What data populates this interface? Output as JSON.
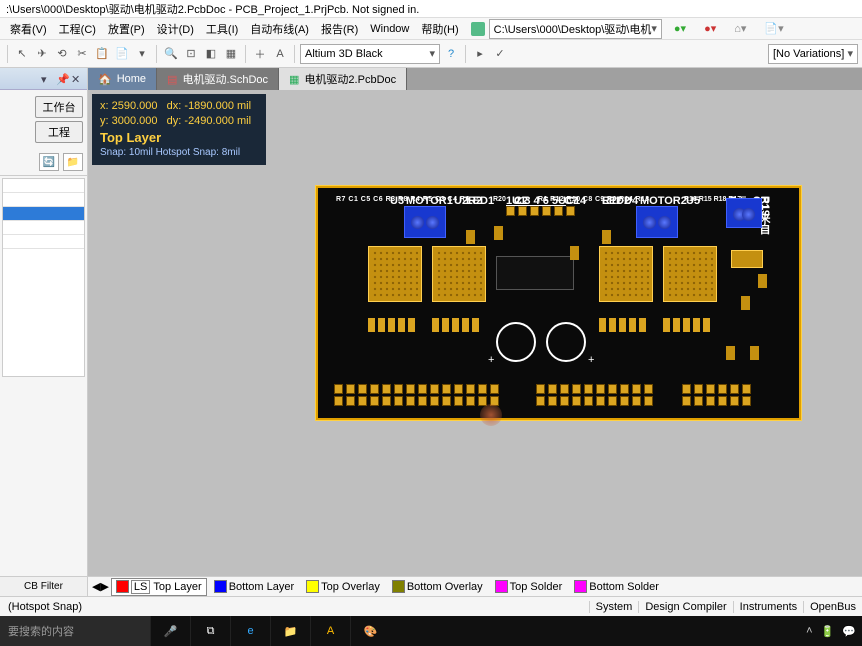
{
  "title": ":\\Users\\000\\Desktop\\驱动\\电机驱动2.PcbDoc - PCB_Project_1.PrjPcb. Not signed in.",
  "menus": {
    "m0": "察看(V)",
    "m1": "工程(C)",
    "m2": "放置(P)",
    "m3": "设计(D)",
    "m4": "工具(I)",
    "m5": "自动布线(A)",
    "m6": "报告(R)",
    "m7": "Window",
    "m8": "帮助(H)"
  },
  "breadcrumb": "C:\\Users\\000\\Desktop\\驱动\\电机",
  "toolbar": {
    "theme": "Altium 3D Black",
    "variations": "[No Variations]"
  },
  "sidebar": {
    "btn1": "工作台",
    "btn2": "工程",
    "footer": "CB Filter"
  },
  "tabs": {
    "home": "Home",
    "t1": "电机驱动.SchDoc",
    "t2": "电机驱动2.PcbDoc"
  },
  "coords": {
    "x": "x: 2590.000",
    "dx": "dx: -1890.000 mil",
    "y": "y: 3000.000",
    "dy": "dy: -2490.000 mil",
    "layer": "Top Layer",
    "snap": "Snap: 10mil Hotspot Snap: 8mil"
  },
  "pcb": {
    "designators": {
      "motor1": "MOTOR1",
      "motor2": "MOTOR2",
      "led1": "LED1",
      "led2": "LED2",
      "hdr": "1 2 3 4 6 5U",
      "r2": "R2",
      "r11": "R11",
      "r20": "R20",
      "c14": "C14",
      "u1": "U1",
      "u2": "U2",
      "u3": "U3",
      "u4": "U4",
      "u5": "U5",
      "c2": "C2",
      "c7": "C7",
      "row_l": "R7  C1  C5  C6  R3  R8  R4  R5  C3  C4  R6",
      "row_m": "R1 R12  R10  C8  C9 R9  R14  R13",
      "row_r": "R16 R15 R18 R17",
      "r19": "R19",
      "c13": "C13",
      "c12": "C12",
      "led3": "LED3",
      "p1": "P1 来自"
    }
  },
  "layers": {
    "ls": "LS",
    "top": "Top Layer",
    "bot": "Bottom Layer",
    "topov": "Top Overlay",
    "botov": "Bottom Overlay",
    "tops": "Top Solder",
    "bots": "Bottom Solder"
  },
  "status": {
    "snap": "(Hotspot Snap)",
    "r1": "System",
    "r2": "Design Compiler",
    "r3": "Instruments",
    "r4": "OpenBus"
  },
  "taskbar": {
    "search": "要搜索的内容"
  }
}
